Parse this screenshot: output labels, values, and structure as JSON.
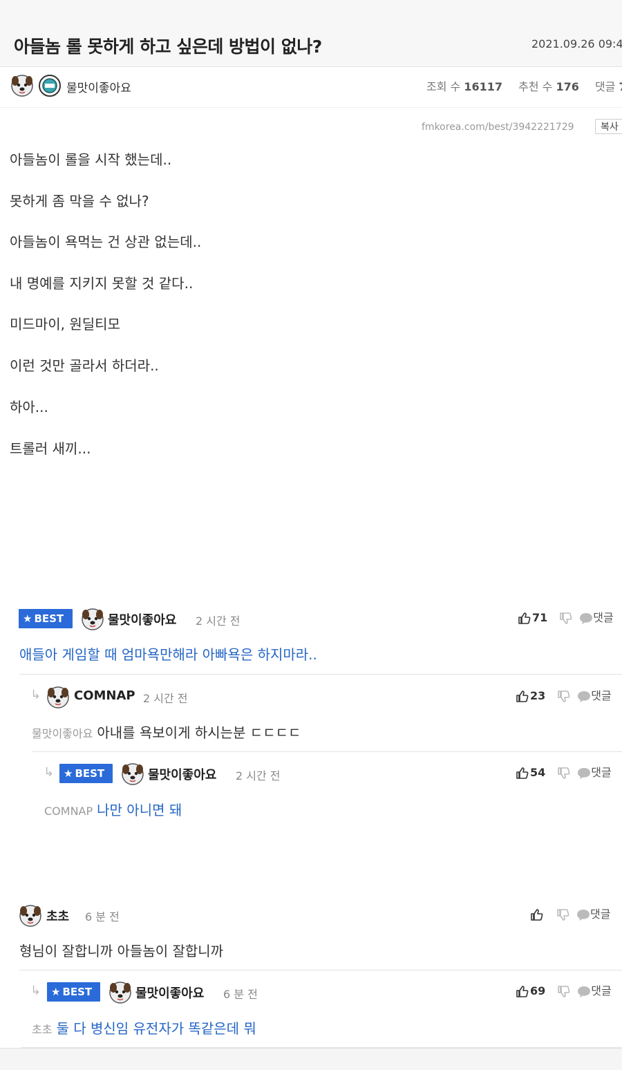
{
  "post": {
    "title": "아들놈 롤 못하게 하고 싶은데 방법이 없나?",
    "date": "2021.09.26 09:4",
    "author": "물맛이좋아요",
    "views_label": "조회 수",
    "views": "16117",
    "recommend_label": "추천 수",
    "recommend": "176",
    "comments_label": "댓글",
    "comments": "7",
    "url": "fmkorea.com/best/3942221729",
    "copy_label": "복사",
    "body": [
      "아들놈이 롤을 시작 했는데..",
      "못하게 좀 막을 수 없나?",
      "아들놈이 욕먹는 건 상관 없는데..",
      "내 명예를 지키지 못할 것 같다..",
      "미드마이, 원딜티모",
      "이런 것만 골라서 하더라..",
      "하아...",
      "트롤러 새끼..."
    ]
  },
  "comments": [
    {
      "best": "BEST",
      "author": "물맛이좋아요",
      "time": "2 시간 전",
      "mention": "",
      "text": "애들아 게임할 때 엄마욕만해라 아빠욕은 하지마라..",
      "likes": "71",
      "reply": "댓글"
    },
    {
      "best": "",
      "author": "COMNAP",
      "time": "2 시간 전",
      "mention": "물맛이좋아요",
      "text": "아내를 욕보이게 하시는분 ㄷㄷㄷㄷ",
      "likes": "23",
      "reply": "댓글"
    },
    {
      "best": "BEST",
      "author": "물맛이좋아요",
      "time": "2 시간 전",
      "mention": "COMNAP",
      "text": "나만 아니면 돼",
      "likes": "54",
      "reply": "댓글"
    },
    {
      "best": "",
      "author": "초초",
      "time": "6 분 전",
      "mention": "",
      "text": "형님이 잘합니까 아들놈이 잘합니까",
      "likes": "",
      "reply": "댓글"
    },
    {
      "best": "BEST",
      "author": "물맛이좋아요",
      "time": "6 분 전",
      "mention": "초초",
      "text": "둘 다 병신임 유전자가 똑같은데 뭐",
      "likes": "69",
      "reply": "댓글"
    }
  ],
  "icons": {
    "star": "star-icon",
    "reply_arrow": "reply-arrow-icon",
    "thumbs_up": "thumbs-up-icon",
    "thumbs_down": "thumbs-down-icon",
    "chat": "chat-bubble-icon",
    "avatar": "dog-avatar-icon",
    "level_badge": "level-badge-icon"
  },
  "colors": {
    "best_badge": "#2b6bd9",
    "link_text": "#2566c5"
  }
}
